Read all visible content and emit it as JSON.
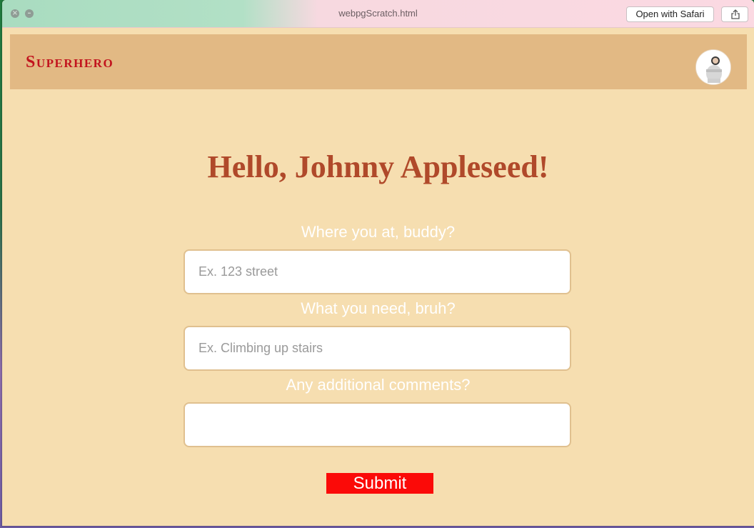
{
  "window": {
    "title": "webpgScratch.html",
    "open_with_label": "Open with Safari",
    "share_icon": "share-icon"
  },
  "nav": {
    "logo": "Superhero",
    "avatar_icon": "profile-avatar"
  },
  "main": {
    "greeting": "Hello, Johnny Appleseed!",
    "fields": [
      {
        "label": "Where you at, buddy?",
        "placeholder": "Ex. 123 street",
        "value": ""
      },
      {
        "label": "What you need, bruh?",
        "placeholder": "Ex. Climbing up stairs",
        "value": ""
      },
      {
        "label": "Any additional comments?",
        "placeholder": "",
        "value": ""
      }
    ],
    "submit_label": "Submit"
  },
  "colors": {
    "page_bg": "#f6deb0",
    "navbar_bg": "#e2b984",
    "logo": "#c2141e",
    "greeting": "#b0492a",
    "submit_bg": "#fb0a08"
  }
}
